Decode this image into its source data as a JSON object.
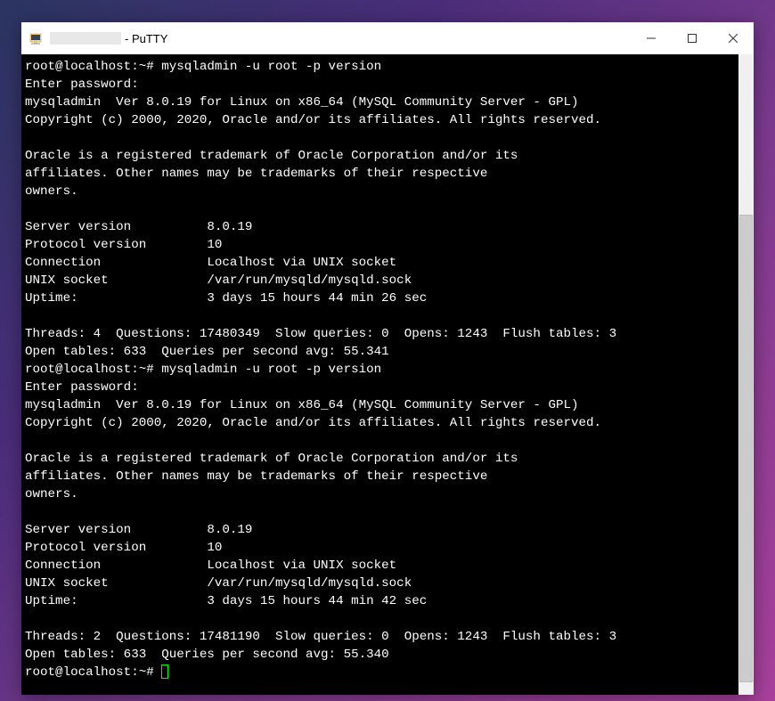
{
  "titlebar": {
    "app_suffix": " - PuTTY"
  },
  "terminal": {
    "lines": [
      "root@localhost:~# mysqladmin -u root -p version",
      "Enter password:",
      "mysqladmin  Ver 8.0.19 for Linux on x86_64 (MySQL Community Server - GPL)",
      "Copyright (c) 2000, 2020, Oracle and/or its affiliates. All rights reserved.",
      "",
      "Oracle is a registered trademark of Oracle Corporation and/or its",
      "affiliates. Other names may be trademarks of their respective",
      "owners.",
      "",
      "Server version          8.0.19",
      "Protocol version        10",
      "Connection              Localhost via UNIX socket",
      "UNIX socket             /var/run/mysqld/mysqld.sock",
      "Uptime:                 3 days 15 hours 44 min 26 sec",
      "",
      "Threads: 4  Questions: 17480349  Slow queries: 0  Opens: 1243  Flush tables: 3",
      "Open tables: 633  Queries per second avg: 55.341",
      "root@localhost:~# mysqladmin -u root -p version",
      "Enter password:",
      "mysqladmin  Ver 8.0.19 for Linux on x86_64 (MySQL Community Server - GPL)",
      "Copyright (c) 2000, 2020, Oracle and/or its affiliates. All rights reserved.",
      "",
      "Oracle is a registered trademark of Oracle Corporation and/or its",
      "affiliates. Other names may be trademarks of their respective",
      "owners.",
      "",
      "Server version          8.0.19",
      "Protocol version        10",
      "Connection              Localhost via UNIX socket",
      "UNIX socket             /var/run/mysqld/mysqld.sock",
      "Uptime:                 3 days 15 hours 44 min 42 sec",
      "",
      "Threads: 2  Questions: 17481190  Slow queries: 0  Opens: 1243  Flush tables: 3",
      "Open tables: 633  Queries per second avg: 55.340"
    ],
    "prompt": "root@localhost:~# "
  },
  "scrollbar": {
    "thumb_top_pct": 25,
    "thumb_height_pct": 73
  }
}
